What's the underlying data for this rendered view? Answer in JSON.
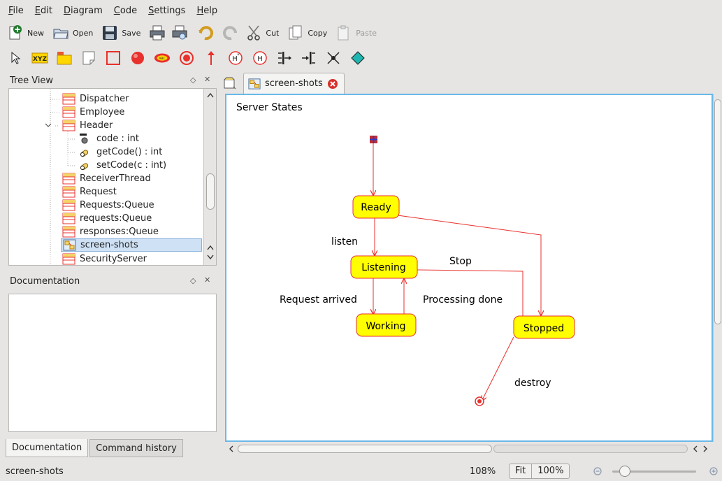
{
  "menu": [
    "File",
    "Edit",
    "Diagram",
    "Code",
    "Settings",
    "Help"
  ],
  "menu_mnemonic_index": [
    0,
    0,
    0,
    0,
    0,
    0
  ],
  "toolbar": {
    "new": "New",
    "open": "Open",
    "save": "Save",
    "cut": "Cut",
    "copy": "Copy",
    "paste": "Paste"
  },
  "tools": [
    "select-arrow",
    "class-xyz-icon",
    "package-icon",
    "note-icon",
    "box-icon",
    "initial-state-icon",
    "activity-icon",
    "final-state-icon",
    "transition-arrow-icon",
    "deep-history-icon",
    "shallow-history-icon",
    "fork-icon",
    "join-icon",
    "junction-icon",
    "choice-icon"
  ],
  "tree_view": {
    "title": "Tree View",
    "items": [
      {
        "label": "Dispatcher",
        "type": "class"
      },
      {
        "label": "Employee",
        "type": "class"
      },
      {
        "label": "Header",
        "type": "class",
        "expanded": true
      },
      {
        "label": "code : int",
        "type": "attribute"
      },
      {
        "label": "getCode() : int",
        "type": "operation"
      },
      {
        "label": "setCode(c : int)",
        "type": "operation"
      },
      {
        "label": "ReceiverThread",
        "type": "class"
      },
      {
        "label": "Request",
        "type": "class"
      },
      {
        "label": "Requests:Queue",
        "type": "class"
      },
      {
        "label": "requests:Queue",
        "type": "class"
      },
      {
        "label": "responses:Queue",
        "type": "class"
      },
      {
        "label": "screen-shots",
        "type": "diagram",
        "selected": true
      },
      {
        "label": "SecurityServer",
        "type": "class"
      }
    ]
  },
  "documentation": {
    "title": "Documentation"
  },
  "bottom_tabs": [
    "Documentation",
    "Command history"
  ],
  "diagram_tab": {
    "label": "screen-shots"
  },
  "diagram": {
    "title": "Server States",
    "states": [
      "Ready",
      "Listening",
      "Working",
      "Stopped"
    ],
    "transitions": [
      "listen",
      "Stop",
      "Request arrived",
      "Processing done",
      "destroy"
    ]
  },
  "status": {
    "left": "screen-shots",
    "zoom_level": "108%",
    "fit": "Fit",
    "zoom_100": "100%",
    "zoom_slider_fraction": 0.15
  },
  "colors": {
    "state_fill": "#ffff00",
    "line": "#e8302c",
    "canvas_border": "#6bb8e8",
    "selection": "#cfe1f5"
  }
}
